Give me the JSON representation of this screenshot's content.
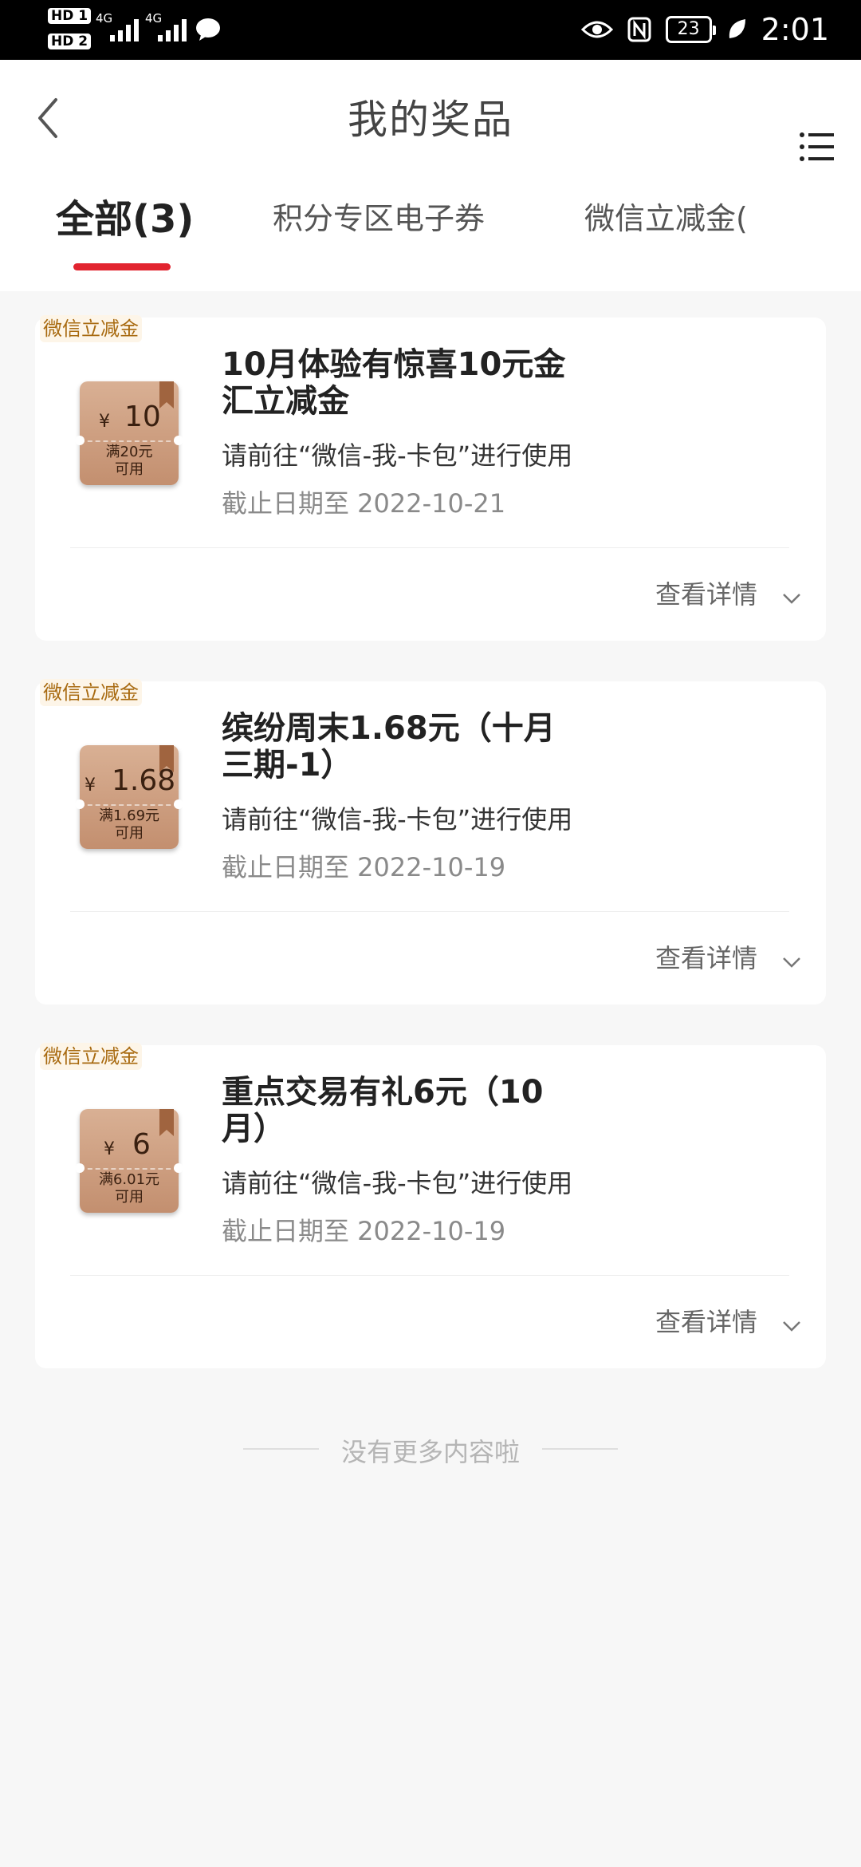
{
  "status_bar": {
    "hd1": "HD 1",
    "hd2": "HD 2",
    "network1": "4G",
    "network2": "4G",
    "battery": "23",
    "time": "2:01",
    "icons": [
      "signal-icon",
      "wechat-notification-icon",
      "eye-icon",
      "nfc-icon",
      "battery-icon",
      "leaf-icon"
    ]
  },
  "header": {
    "title": "我的奖品",
    "tabs": [
      {
        "label": "全部(3)",
        "active": true
      },
      {
        "label": "积分专区电子券",
        "active": false
      },
      {
        "label": "微信立减金(",
        "active": false
      }
    ]
  },
  "colors": {
    "accent": "#e2242f",
    "coupon": "#c9977a",
    "tag_text": "#a86a10"
  },
  "prizes": [
    {
      "tag": "微信立减金",
      "coupon_symbol": "¥",
      "coupon_amount": "10",
      "coupon_condition_1": "满20元",
      "coupon_condition_2": "可用",
      "title_line1": "10月体验有惊喜10元金",
      "title_line2": "汇立减金",
      "instruction": "请前往“微信-我-卡包”进行使用",
      "expiry": "截止日期至 2022-10-21",
      "detail_label": "查看详情"
    },
    {
      "tag": "微信立减金",
      "coupon_symbol": "¥",
      "coupon_amount": "1.68",
      "coupon_condition_1": "满1.69元",
      "coupon_condition_2": "可用",
      "title_line1": "缤纷周末1.68元（十月",
      "title_line2": "三期-1）",
      "instruction": "请前往“微信-我-卡包”进行使用",
      "expiry": "截止日期至 2022-10-19",
      "detail_label": "查看详情"
    },
    {
      "tag": "微信立减金",
      "coupon_symbol": "¥",
      "coupon_amount": "6",
      "coupon_condition_1": "满6.01元",
      "coupon_condition_2": "可用",
      "title_line1": "重点交易有礼6元（10",
      "title_line2": "月）",
      "instruction": "请前往“微信-我-卡包”进行使用",
      "expiry": "截止日期至 2022-10-19",
      "detail_label": "查看详情"
    }
  ],
  "footer": {
    "end_note": "没有更多内容啦"
  }
}
